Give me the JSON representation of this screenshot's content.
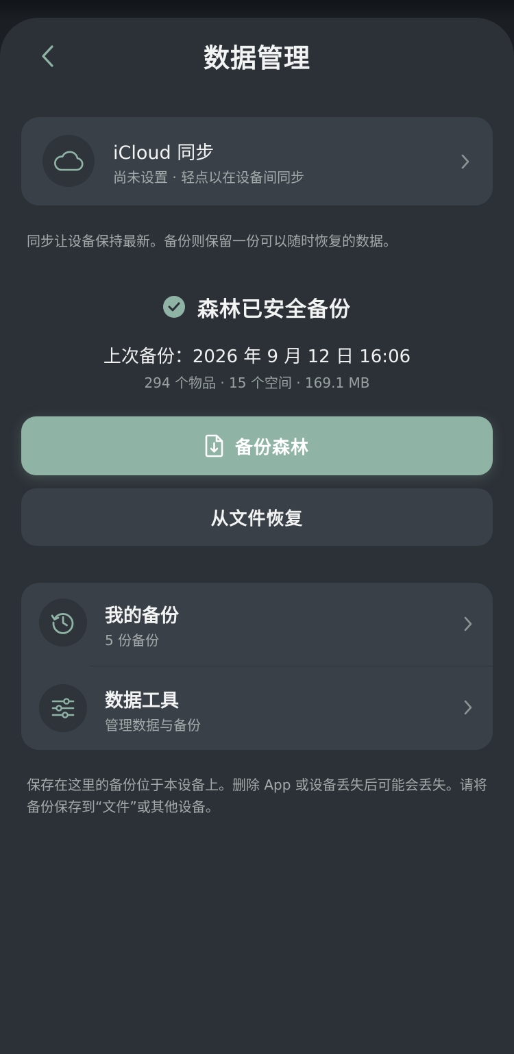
{
  "header": {
    "title": "数据管理"
  },
  "icloud": {
    "title": "iCloud 同步",
    "subtitle": "尚未设置 · 轻点以在设备间同步"
  },
  "sync_help": "同步让设备保持最新。备份则保留一份可以随时恢复的数据。",
  "status": {
    "headline": "森林已安全备份",
    "last_backup": "上次备份：2026 年 9 月 12 日 16:06",
    "meta": "294 个物品 · 15 个空间 · 169.1 MB"
  },
  "actions": {
    "backup_label": "备份森林",
    "restore_label": "从文件恢复"
  },
  "list": {
    "items": [
      {
        "title": "我的备份",
        "subtitle": "5 份备份",
        "icon": "history-icon"
      },
      {
        "title": "数据工具",
        "subtitle": "管理数据与备份",
        "icon": "sliders-icon"
      }
    ]
  },
  "storage_help": "保存在这里的备份位于本设备上。删除 App 或设备丢失后可能会丢失。请将备份保存到“文件”或其他设备。",
  "colors": {
    "accent": "#8fb4a5",
    "background": "#2c3137",
    "card": "#3a4047",
    "secondary_text": "#a3aaa9"
  }
}
